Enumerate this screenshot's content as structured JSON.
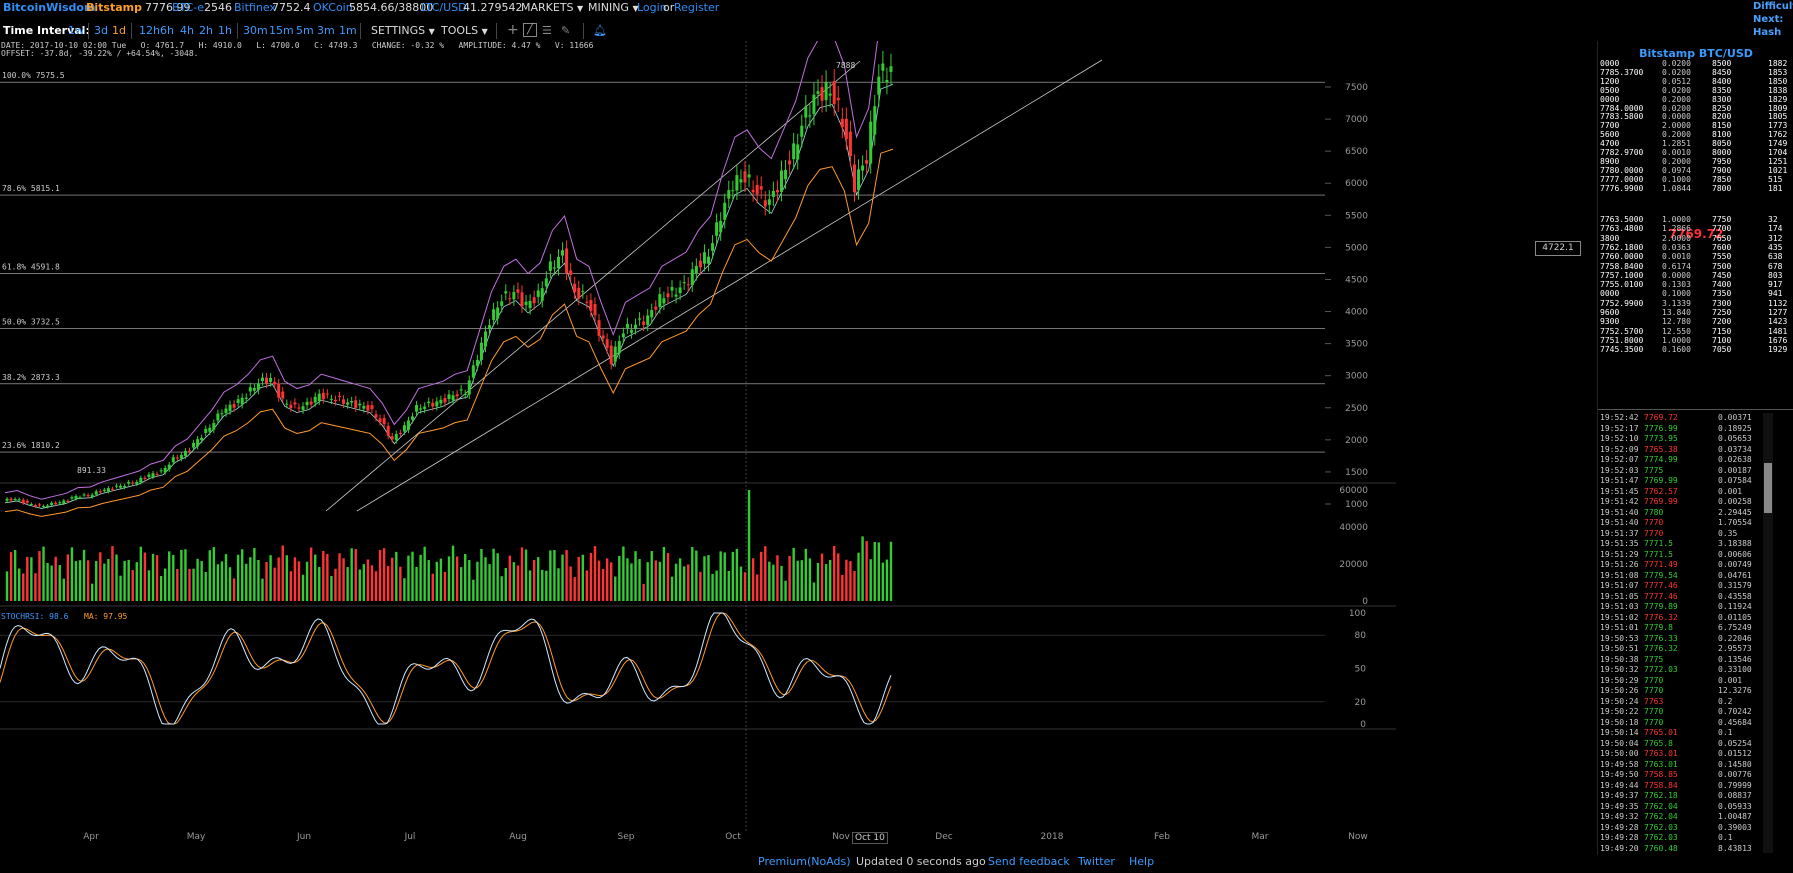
{
  "topbar": {
    "brand": "BitcoinWisdom",
    "tickers": [
      {
        "name": "Bitstamp",
        "price": "7776.99"
      },
      {
        "name": "BTC-e",
        "price": "2546"
      },
      {
        "name": "Bitfinex",
        "price": "7752.4"
      },
      {
        "name": "OKCoin",
        "price": "5854.66/38800"
      },
      {
        "name": "LTC/USD",
        "price": "41.279542"
      }
    ],
    "markets_label": "MARKETS",
    "mining_label": "MINING",
    "login_label": "Login",
    "or_label": "or",
    "register_label": "Register",
    "difficulty_lines": [
      "Difficult",
      "Next:",
      "Hash Ra"
    ]
  },
  "toolbar": {
    "interval_label": "Time Interval:",
    "intervals": [
      "1w",
      "3d",
      "1d",
      "12h",
      "6h",
      "4h",
      "2h",
      "1h",
      "30m",
      "15m",
      "5m",
      "3m",
      "1m"
    ],
    "settings_label": "SETTINGS",
    "tools_label": "TOOLS"
  },
  "info": {
    "line1": "DATE: 2017-10-10 02:00 Tue   O: 4761.7   H: 4910.0   L: 4700.0   C: 4749.3   CHANGE: -0.32 %   AMPLITUDE: 4.47 %   V: 11666",
    "line2": "OFFSET: -37.8d, -39.22% / +64.54%, -3048.",
    "crosshair_price": "4722.1",
    "high_marker": "7888",
    "low_marker": "891.33",
    "stochrsi_label": "STOCHRSI: 98.6",
    "ma_label": "MA: 97.95",
    "cursor_date": "Oct 10"
  },
  "chart_data": {
    "type": "line",
    "title": "Bitstamp BTC/USD",
    "x_labels": [
      "Apr",
      "May",
      "Jun",
      "Jul",
      "Aug",
      "Sep",
      "Oct",
      "Nov",
      "Dec",
      "2018",
      "Feb",
      "Mar",
      "Now"
    ],
    "price_ticks": [
      7500,
      7000,
      6500,
      6000,
      5500,
      5000,
      4500,
      4000,
      3500,
      3000,
      2500,
      2000,
      1500,
      1000
    ],
    "volume_ticks": [
      60000,
      40000,
      20000,
      0
    ],
    "stoch_ticks": [
      100,
      80,
      50,
      20,
      0
    ],
    "fib_levels": [
      {
        "label": "100.0% 7575.5",
        "value": 7575.5
      },
      {
        "label": "78.6% 5815.1",
        "value": 5815.1
      },
      {
        "label": "61.8% 4591.8",
        "value": 4591.8
      },
      {
        "label": "50.0% 3732.5",
        "value": 3732.5
      },
      {
        "label": "38.2% 2873.3",
        "value": 2873.3
      },
      {
        "label": "23.6% 1810.2",
        "value": 1810.2
      }
    ],
    "price_series": [
      1050,
      1080,
      1010,
      960,
      1000,
      1040,
      1120,
      1130,
      1200,
      1250,
      1300,
      1350,
      1450,
      1500,
      1700,
      1800,
      2000,
      2200,
      2450,
      2550,
      2700,
      2900,
      2950,
      2600,
      2500,
      2550,
      2700,
      2650,
      2600,
      2550,
      2500,
      2300,
      2000,
      2200,
      2500,
      2550,
      2600,
      2700,
      2750,
      3300,
      3850,
      4200,
      4300,
      4100,
      4250,
      4700,
      4900,
      4300,
      4200,
      3700,
      3250,
      3700,
      3800,
      3900,
      4200,
      4300,
      4400,
      4700,
      4900,
      5500,
      6000,
      6100,
      5850,
      5700,
      6100,
      6500,
      7100,
      7400,
      7450,
      7000,
      6000,
      6400,
      7700,
      7776
    ]
  },
  "orderbook": {
    "title": "Bitstamp BTC/USD",
    "asks": [
      {
        "price": "0000",
        "amount": "0.0200",
        "total": "8500",
        "cum": "1882"
      },
      {
        "price": "7785.3700",
        "amount": "0.0200",
        "total": "8450",
        "cum": "1853"
      },
      {
        "price": "1200",
        "amount": "0.0512",
        "total": "8400",
        "cum": "1850"
      },
      {
        "price": "0500",
        "amount": "0.0200",
        "total": "8350",
        "cum": "1838"
      },
      {
        "price": "0000",
        "amount": "0.2000",
        "total": "8300",
        "cum": "1829"
      },
      {
        "price": "7784.0000",
        "amount": "0.0200",
        "total": "8250",
        "cum": "1809"
      },
      {
        "price": "7783.5800",
        "amount": "0.0000",
        "total": "8200",
        "cum": "1805"
      },
      {
        "price": "7700",
        "amount": "2.0000",
        "total": "8150",
        "cum": "1773"
      },
      {
        "price": "5600",
        "amount": "0.2000",
        "total": "8100",
        "cum": "1762"
      },
      {
        "price": "4700",
        "amount": "1.2851",
        "total": "8050",
        "cum": "1749"
      },
      {
        "price": "7782.9700",
        "amount": "0.0010",
        "total": "8000",
        "cum": "1704"
      },
      {
        "price": "8900",
        "amount": "0.2000",
        "total": "7950",
        "cum": "1251"
      },
      {
        "price": "7780.0000",
        "amount": "0.0974",
        "total": "7900",
        "cum": "1021"
      },
      {
        "price": "7777.0000",
        "amount": "0.1000",
        "total": "7850",
        "cum": "515"
      },
      {
        "price": "7776.9900",
        "amount": "1.0844",
        "total": "7800",
        "cum": "181"
      }
    ],
    "last_price": "7769.72",
    "bids": [
      {
        "price": "7763.5000",
        "amount": "1.0000",
        "total": "7750",
        "cum": "32"
      },
      {
        "price": "7763.4800",
        "amount": "1.2866",
        "total": "7700",
        "cum": "174"
      },
      {
        "price": "3800",
        "amount": "2.0000",
        "total": "7650",
        "cum": "312"
      },
      {
        "price": "7762.1800",
        "amount": "0.0363",
        "total": "7600",
        "cum": "435"
      },
      {
        "price": "7760.0000",
        "amount": "0.0010",
        "total": "7550",
        "cum": "638"
      },
      {
        "price": "7758.8400",
        "amount": "0.6174",
        "total": "7500",
        "cum": "678"
      },
      {
        "price": "7757.1000",
        "amount": "0.0000",
        "total": "7450",
        "cum": "803"
      },
      {
        "price": "7755.0100",
        "amount": "0.1303",
        "total": "7400",
        "cum": "917"
      },
      {
        "price": "0000",
        "amount": "0.1000",
        "total": "7350",
        "cum": "941"
      },
      {
        "price": "7752.9900",
        "amount": "3.1339",
        "total": "7300",
        "cum": "1132"
      },
      {
        "price": "9600",
        "amount": "13.840",
        "total": "7250",
        "cum": "1277"
      },
      {
        "price": "9300",
        "amount": "12.780",
        "total": "7200",
        "cum": "1423"
      },
      {
        "price": "7752.5700",
        "amount": "12.550",
        "total": "7150",
        "cum": "1481"
      },
      {
        "price": "7751.8000",
        "amount": "1.0000",
        "total": "7100",
        "cum": "1676"
      },
      {
        "price": "7745.3500",
        "amount": "0.1600",
        "total": "7050",
        "cum": "1929"
      }
    ]
  },
  "trades": [
    {
      "time": "19:52:42",
      "price": "7769.72",
      "amount": "0.00371",
      "side": "sell"
    },
    {
      "time": "19:52:17",
      "price": "7776.99",
      "amount": "0.18925",
      "side": "buy"
    },
    {
      "time": "19:52:10",
      "price": "7773.95",
      "amount": "0.05653",
      "side": "buy"
    },
    {
      "time": "19:52:09",
      "price": "7765.38",
      "amount": "0.03734",
      "side": "sell"
    },
    {
      "time": "19:52:07",
      "price": "7774.99",
      "amount": "0.02638",
      "side": "buy"
    },
    {
      "time": "19:52:03",
      "price": "7775",
      "amount": "0.00187",
      "side": "buy"
    },
    {
      "time": "19:51:47",
      "price": "7769.99",
      "amount": "0.07584",
      "side": "buy"
    },
    {
      "time": "19:51:45",
      "price": "7762.57",
      "amount": "0.001",
      "side": "sell"
    },
    {
      "time": "19:51:42",
      "price": "7769.99",
      "amount": "0.00258",
      "side": "sell"
    },
    {
      "time": "19:51:40",
      "price": "7780",
      "amount": "2.29445",
      "side": "buy"
    },
    {
      "time": "19:51:40",
      "price": "7770",
      "amount": "1.70554",
      "side": "sell"
    },
    {
      "time": "19:51:37",
      "price": "7770",
      "amount": "0.35",
      "side": "sell"
    },
    {
      "time": "19:51:35",
      "price": "7771.5",
      "amount": "3.18388",
      "side": "buy"
    },
    {
      "time": "19:51:29",
      "price": "7771.5",
      "amount": "0.00606",
      "side": "buy"
    },
    {
      "time": "19:51:26",
      "price": "7771.49",
      "amount": "0.00749",
      "side": "sell"
    },
    {
      "time": "19:51:08",
      "price": "7779.54",
      "amount": "0.04761",
      "side": "buy"
    },
    {
      "time": "19:51:07",
      "price": "7777.46",
      "amount": "0.31579",
      "side": "sell"
    },
    {
      "time": "19:51:05",
      "price": "7777.46",
      "amount": "0.43558",
      "side": "sell"
    },
    {
      "time": "19:51:03",
      "price": "7779.89",
      "amount": "0.11924",
      "side": "buy"
    },
    {
      "time": "19:51:02",
      "price": "7776.32",
      "amount": "0.01105",
      "side": "sell"
    },
    {
      "time": "19:51:01",
      "price": "7779.8",
      "amount": "6.75249",
      "side": "buy"
    },
    {
      "time": "19:50:53",
      "price": "7776.33",
      "amount": "0.22046",
      "side": "buy"
    },
    {
      "time": "19:50:51",
      "price": "7776.32",
      "amount": "2.95573",
      "side": "buy"
    },
    {
      "time": "19:50:38",
      "price": "7775",
      "amount": "0.13546",
      "side": "buy"
    },
    {
      "time": "19:50:32",
      "price": "7772.03",
      "amount": "0.33100",
      "side": "buy"
    },
    {
      "time": "19:50:29",
      "price": "7770",
      "amount": "0.001",
      "side": "buy"
    },
    {
      "time": "19:50:26",
      "price": "7770",
      "amount": "12.3276",
      "side": "buy"
    },
    {
      "time": "19:50:24",
      "price": "7763",
      "amount": "0.2",
      "side": "sell"
    },
    {
      "time": "19:50:22",
      "price": "7770",
      "amount": "0.70242",
      "side": "buy"
    },
    {
      "time": "19:50:18",
      "price": "7770",
      "amount": "0.45684",
      "side": "buy"
    },
    {
      "time": "19:50:14",
      "price": "7765.01",
      "amount": "0.1",
      "side": "sell"
    },
    {
      "time": "19:50:04",
      "price": "7765.8",
      "amount": "0.05254",
      "side": "buy"
    },
    {
      "time": "19:50:00",
      "price": "7763.01",
      "amount": "0.01512",
      "side": "sell"
    },
    {
      "time": "19:49:58",
      "price": "7763.01",
      "amount": "0.14580",
      "side": "buy"
    },
    {
      "time": "19:49:50",
      "price": "7758.85",
      "amount": "0.00776",
      "side": "sell"
    },
    {
      "time": "19:49:44",
      "price": "7758.84",
      "amount": "0.79999",
      "side": "sell"
    },
    {
      "time": "19:49:37",
      "price": "7762.18",
      "amount": "0.08837",
      "side": "buy"
    },
    {
      "time": "19:49:35",
      "price": "7762.04",
      "amount": "0.05933",
      "side": "buy"
    },
    {
      "time": "19:49:32",
      "price": "7762.04",
      "amount": "1.00487",
      "side": "buy"
    },
    {
      "time": "19:49:28",
      "price": "7762.03",
      "amount": "0.39003",
      "side": "buy"
    },
    {
      "time": "19:49:28",
      "price": "7762.03",
      "amount": "0.1",
      "side": "buy"
    },
    {
      "time": "19:49:20",
      "price": "7760.48",
      "amount": "8.43813",
      "side": "buy"
    }
  ],
  "footer": {
    "premium": "Premium(NoAds)",
    "updated": "Updated 0 seconds ago",
    "feedback": "Send feedback",
    "twitter": "Twitter",
    "help": "Help"
  },
  "colors": {
    "accent": "#3a9bff",
    "up": "#33cc33",
    "down": "#ff3333",
    "boll_upper": "#c070e0",
    "boll_lower": "#ff9a2a"
  }
}
